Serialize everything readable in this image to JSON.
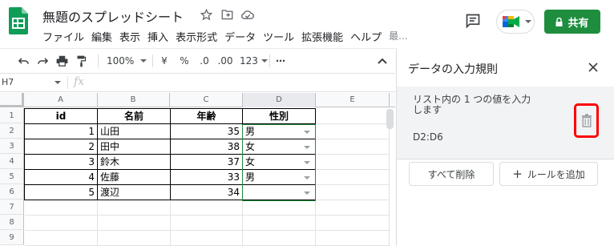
{
  "app": {
    "doc_title": "無題のスプレッドシート",
    "share_label": "共有",
    "menu": [
      "ファイル",
      "編集",
      "表示",
      "挿入",
      "表示形式",
      "データ",
      "ツール",
      "拡張機能",
      "ヘルプ"
    ],
    "menu_overflow": "最..."
  },
  "toolbar": {
    "zoom": "100%",
    "currency": "¥",
    "percent": "%",
    "decrease_decimals": ".0",
    "increase_decimals": ".00",
    "number_format": "123",
    "more": "⋯"
  },
  "formula_bar": {
    "cell_ref": "H7",
    "fx": "fx"
  },
  "grid": {
    "columns": [
      "A",
      "B",
      "C",
      "D",
      "E"
    ],
    "rows": [
      "1",
      "2",
      "3",
      "4",
      "5",
      "6",
      "7",
      "8",
      "9"
    ],
    "header_cells": [
      "id",
      "名前",
      "年齢",
      "性別"
    ],
    "data_rows": [
      {
        "id": "1",
        "name": "山田",
        "age": "35",
        "gender": "男"
      },
      {
        "id": "2",
        "name": "田中",
        "age": "38",
        "gender": "女"
      },
      {
        "id": "3",
        "name": "鈴木",
        "age": "37",
        "gender": "女"
      },
      {
        "id": "4",
        "name": "佐藤",
        "age": "33",
        "gender": "男"
      },
      {
        "id": "5",
        "name": "渡辺",
        "age": "34",
        "gender": ""
      }
    ]
  },
  "panel": {
    "title": "データの入力規則",
    "rule_description": "リスト内の 1 つの値を入力します",
    "rule_range": "D2:D6",
    "remove_all_label": "すべて削除",
    "add_rule_label": "ルールを追加"
  },
  "colors": {
    "share_green": "#1e8e3e",
    "sheets_green": "#0f9d58",
    "highlight_red": "#ff0000"
  }
}
